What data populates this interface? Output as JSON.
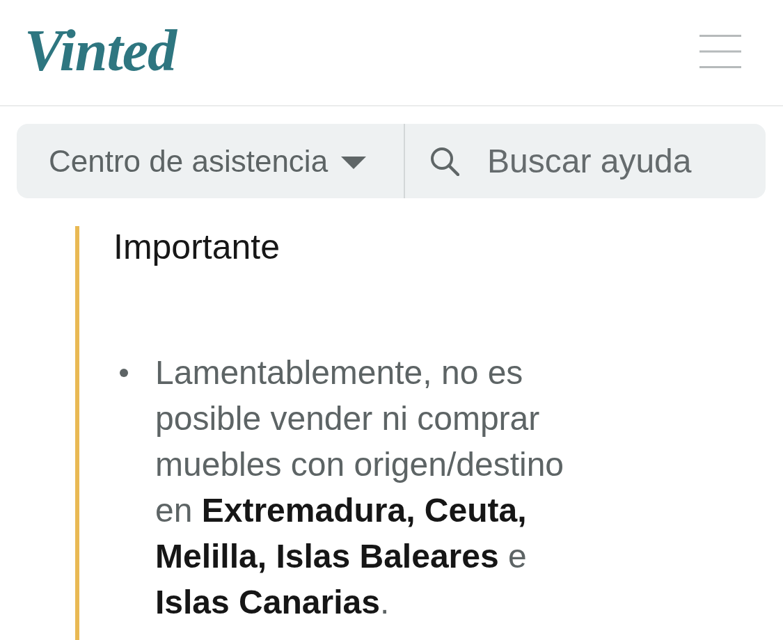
{
  "header": {
    "logo": "Vinted"
  },
  "nav": {
    "section_menu": {
      "label": "Centro de asistencia"
    },
    "search": {
      "placeholder": "Buscar ayuda"
    }
  },
  "notice": {
    "title": "Importante",
    "items": [
      "Lamentablemente, no es posible vender ni comprar muebles con origen/destino en **Extremadura, Ceuta, Melilla, Islas Baleares** e **Islas Canarias**."
    ]
  }
}
